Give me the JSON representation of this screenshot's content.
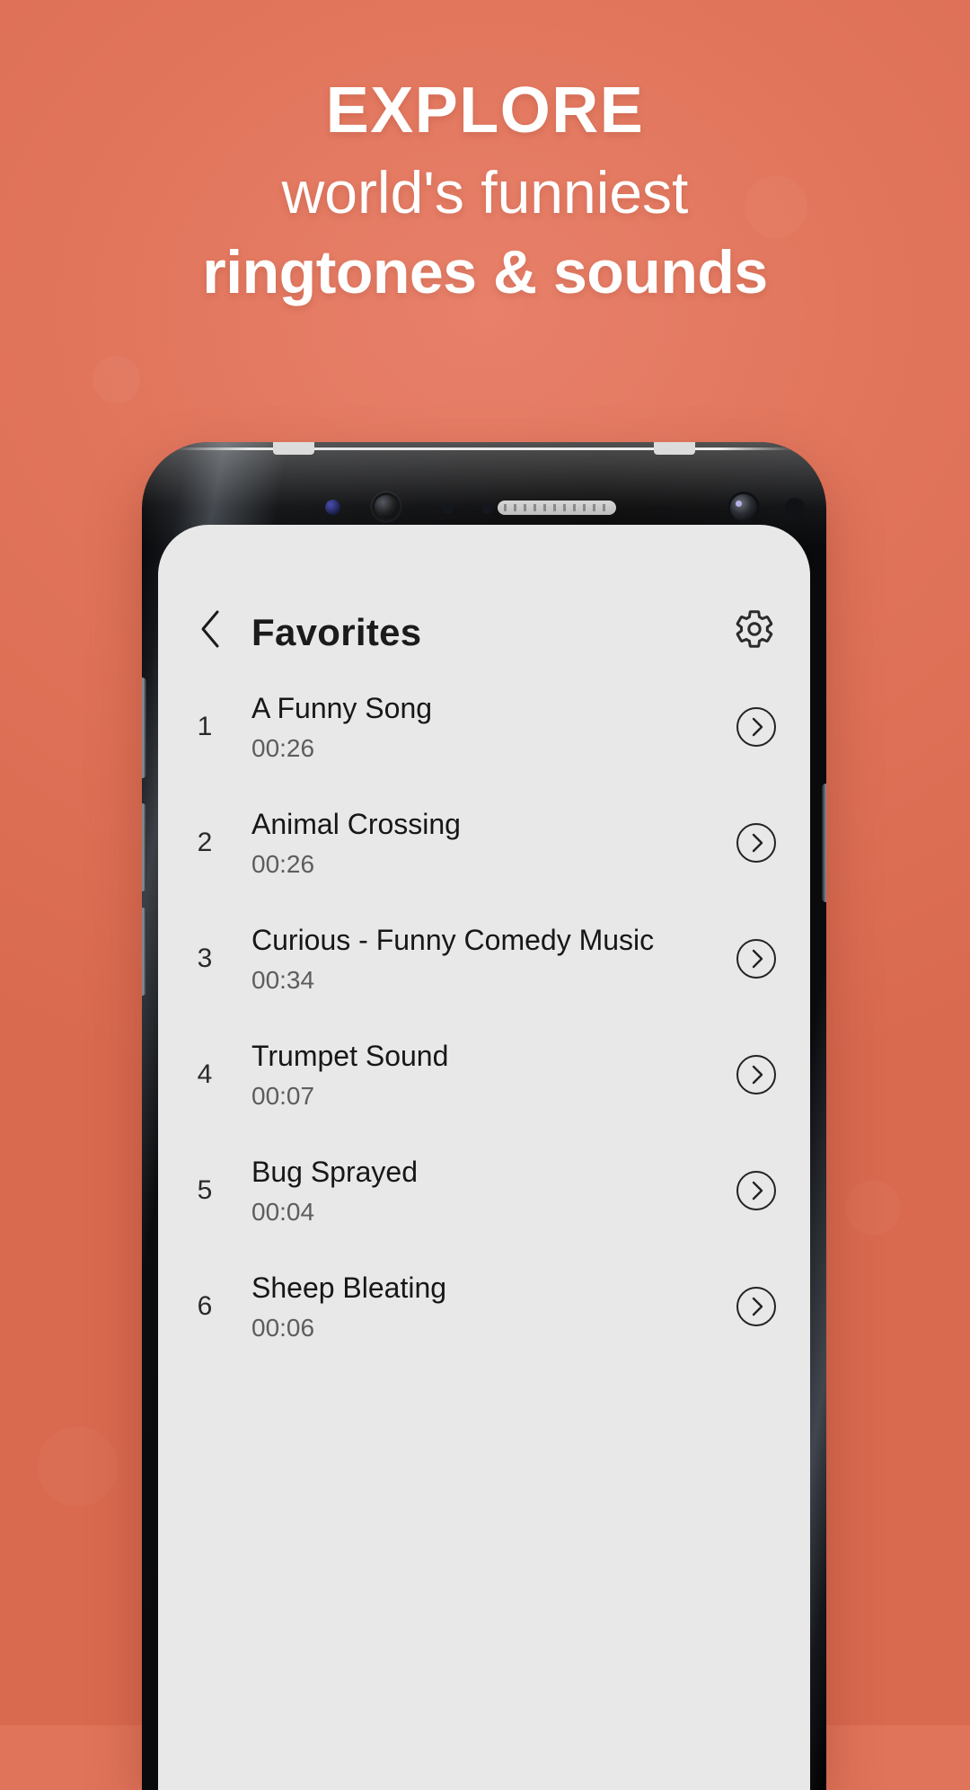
{
  "promo": {
    "line1": "EXPLORE",
    "line2": "world's funniest",
    "line3": "ringtones & sounds",
    "background_color": "#e0745a",
    "text_color": "#ffffff"
  },
  "app": {
    "appbar": {
      "back_icon": "chevron-left-icon",
      "title": "Favorites",
      "settings_icon": "gear-icon"
    },
    "screen_background": "#e8e8e8",
    "list": {
      "chevron_icon": "chevron-right-circle-icon",
      "items": [
        {
          "index": "1",
          "title": "A Funny Song",
          "duration": "00:26"
        },
        {
          "index": "2",
          "title": "Animal Crossing",
          "duration": "00:26"
        },
        {
          "index": "3",
          "title": "Curious - Funny Comedy Music",
          "duration": "00:34"
        },
        {
          "index": "4",
          "title": "Trumpet Sound",
          "duration": "00:07"
        },
        {
          "index": "5",
          "title": "Bug Sprayed",
          "duration": "00:04"
        },
        {
          "index": "6",
          "title": "Sheep Bleating",
          "duration": "00:06"
        }
      ]
    }
  }
}
